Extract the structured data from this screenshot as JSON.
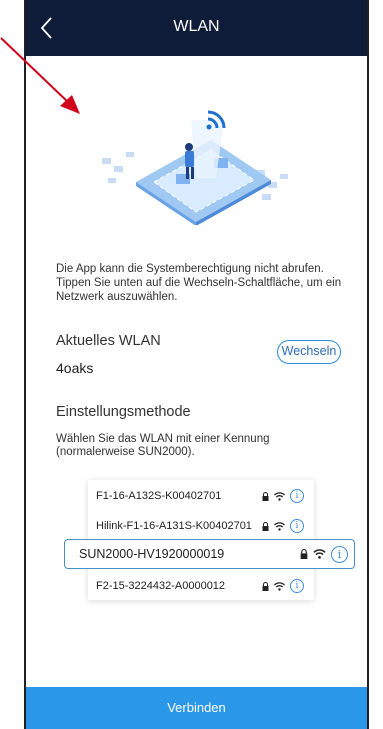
{
  "header": {
    "title": "WLAN",
    "back_icon": "chevron-left-icon"
  },
  "message": "Die App kann die Systemberechtigung nicht abrufen. Tippen Sie unten auf die Wechseln-Schaltfläche, um ein Netzwerk auszuwählen.",
  "current_wlan": {
    "label": "Aktuelles WLAN",
    "value": "4oaks",
    "switch_label": "Wechseln"
  },
  "method": {
    "label": "Einstellungsmethode",
    "description": "Wählen Sie das WLAN mit einer Kennung (normalerweise SUN2000)."
  },
  "networks": [
    {
      "name": "F1-16-A132S-K00402701",
      "selected": false
    },
    {
      "name": "Hilink-F1-16-A131S-K00402701",
      "selected": false
    },
    {
      "name": "SUN2000-HV1920000019",
      "selected": true
    },
    {
      "name": "F2-15-3224432-A0000012",
      "selected": false
    }
  ],
  "connect_label": "Verbinden",
  "colors": {
    "header": "#0e1c3a",
    "accent": "#2b97e8",
    "arrow": "#d0021b"
  }
}
